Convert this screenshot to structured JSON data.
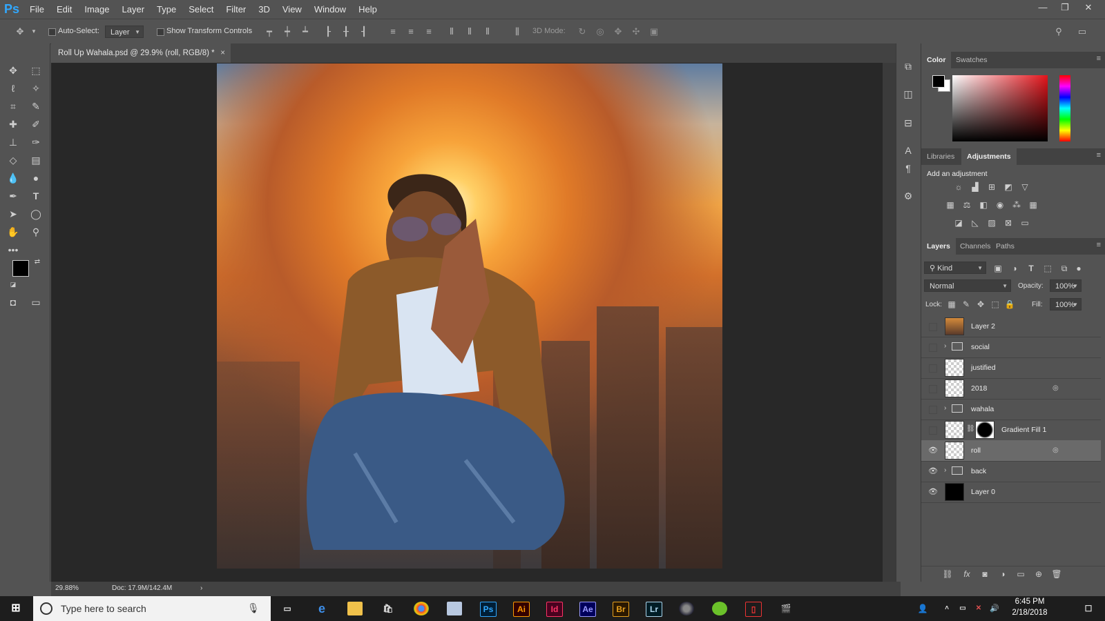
{
  "app": {
    "logo": "Ps",
    "menu": [
      "File",
      "Edit",
      "Image",
      "Layer",
      "Type",
      "Select",
      "Filter",
      "3D",
      "View",
      "Window",
      "Help"
    ]
  },
  "options_bar": {
    "auto_select_label": "Auto-Select:",
    "auto_select_value": "Layer",
    "show_transform_label": "Show Transform Controls",
    "mode_3d_label": "3D Mode:"
  },
  "document": {
    "tab_title": "Roll Up Wahala.psd @ 29.9% (roll, RGB/8) *",
    "close": "×"
  },
  "status": {
    "zoom": "29.88%",
    "doc_size": "Doc: 17.9M/142.4M"
  },
  "panels": {
    "color_tabs": [
      "Color",
      "Swatches"
    ],
    "adjust_tabs": [
      "Libraries",
      "Adjustments"
    ],
    "adjust_heading": "Add an adjustment",
    "layer_tabs": [
      "Layers",
      "Channels",
      "Paths"
    ],
    "kind_label": "Kind",
    "blend_mode": "Normal",
    "opacity_label": "Opacity:",
    "opacity_value": "100%",
    "lock_label": "Lock:",
    "fill_label": "Fill:",
    "fill_value": "100%"
  },
  "layers": [
    {
      "name": "Layer 2",
      "visible": false,
      "type": "image"
    },
    {
      "name": "social",
      "visible": false,
      "type": "group"
    },
    {
      "name": "justified",
      "visible": false,
      "type": "smart"
    },
    {
      "name": "2018",
      "visible": false,
      "type": "smart"
    },
    {
      "name": "wahala",
      "visible": false,
      "type": "group"
    },
    {
      "name": "Gradient Fill 1",
      "visible": false,
      "type": "fill"
    },
    {
      "name": "roll",
      "visible": true,
      "type": "smart",
      "selected": true
    },
    {
      "name": "back",
      "visible": true,
      "type": "group"
    },
    {
      "name": "Layer 0",
      "visible": true,
      "type": "black"
    }
  ],
  "taskbar": {
    "search_placeholder": "Type here to search",
    "time": "6:45 PM",
    "date": "2/18/2018",
    "apps": [
      "Ps",
      "Ai",
      "Id",
      "Ae",
      "Br",
      "Lr"
    ]
  },
  "colors": {
    "ps_blue": "#31a8ff",
    "ai_orange": "#ff9a00",
    "id_pink": "#ff3366",
    "ae_purple": "#9999ff",
    "br_orange": "#e8a11d",
    "lr_blue": "#add5ec"
  }
}
